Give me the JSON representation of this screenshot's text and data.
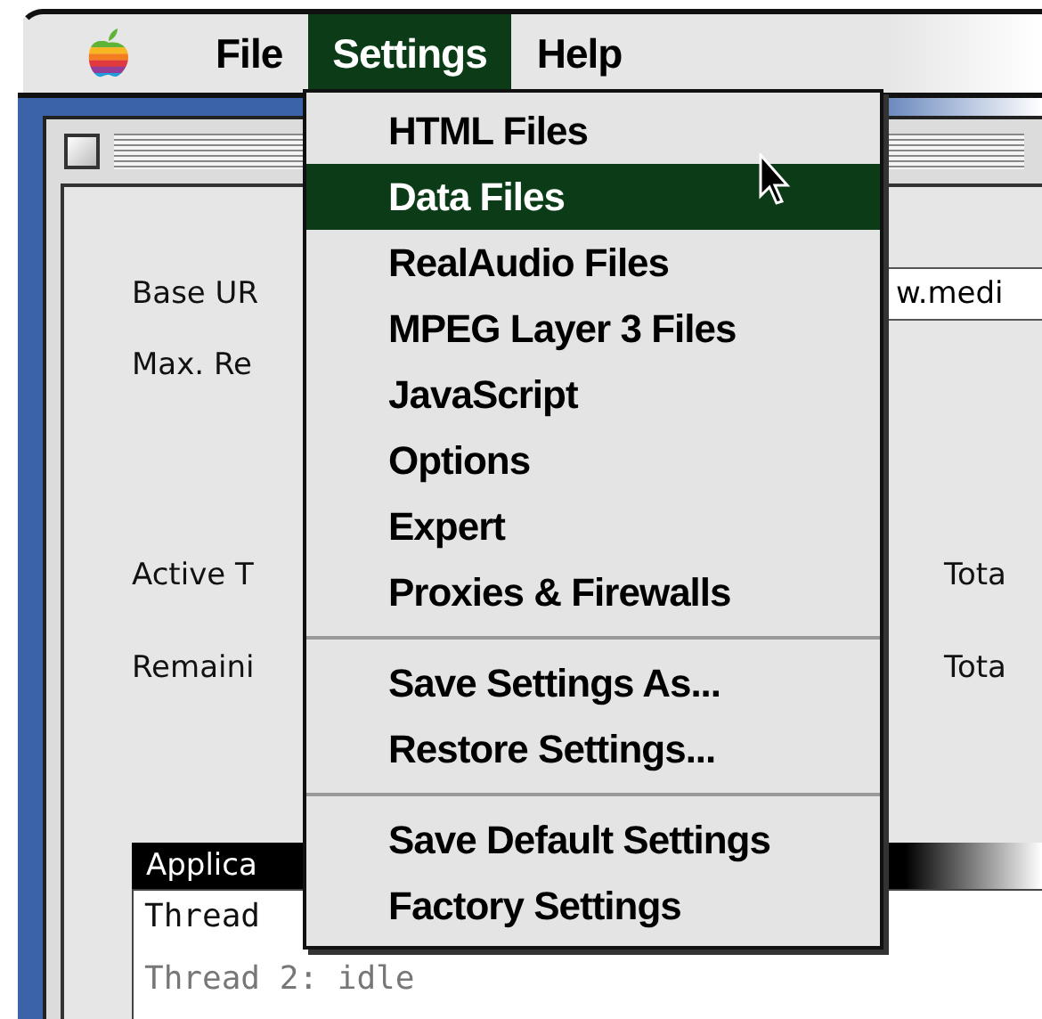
{
  "menubar": {
    "items": [
      {
        "label": "File",
        "selected": false
      },
      {
        "label": "Settings",
        "selected": true
      },
      {
        "label": "Help",
        "selected": false
      }
    ]
  },
  "menu": {
    "items": [
      {
        "kind": "item",
        "label": "HTML Files",
        "selected": false
      },
      {
        "kind": "item",
        "label": "Data Files",
        "selected": true
      },
      {
        "kind": "item",
        "label": "RealAudio Files",
        "selected": false
      },
      {
        "kind": "item",
        "label": "MPEG Layer 3 Files",
        "selected": false
      },
      {
        "kind": "item",
        "label": "JavaScript",
        "selected": false
      },
      {
        "kind": "item",
        "label": "Options",
        "selected": false
      },
      {
        "kind": "item",
        "label": "Expert",
        "selected": false
      },
      {
        "kind": "item",
        "label": "Proxies & Firewalls",
        "selected": false
      },
      {
        "kind": "separator"
      },
      {
        "kind": "item",
        "label": "Save Settings As...",
        "selected": false
      },
      {
        "kind": "item",
        "label": "Restore Settings...",
        "selected": false
      },
      {
        "kind": "separator"
      },
      {
        "kind": "item",
        "label": "Save Default Settings",
        "selected": false
      },
      {
        "kind": "item",
        "label": "Factory Settings",
        "selected": false
      }
    ]
  },
  "form": {
    "rows": [
      {
        "label": "Base UR",
        "value": "w.medi"
      },
      {
        "label": "Max. Re"
      },
      {
        "label": "Active T",
        "right_label": "Tota"
      },
      {
        "label": "Remaini",
        "right_label": "Tota"
      }
    ]
  },
  "log": {
    "header": "Applica",
    "lines": [
      "Thread",
      "Thread 2: idle"
    ]
  }
}
